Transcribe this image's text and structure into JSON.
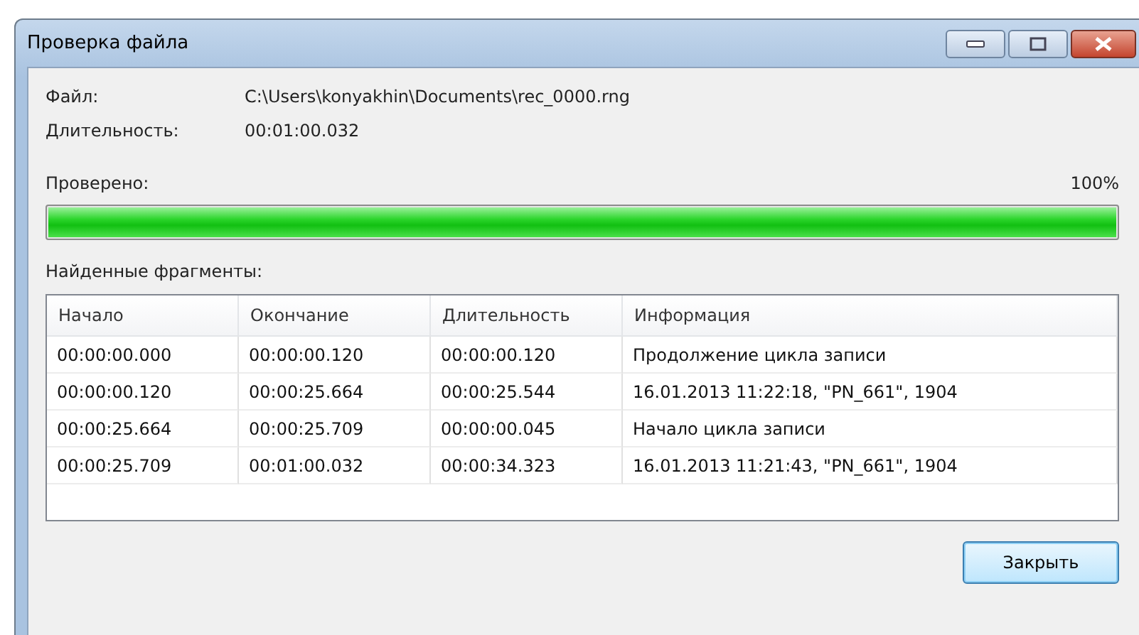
{
  "window": {
    "title": "Проверка файла"
  },
  "file": {
    "label": "Файл:",
    "value": "C:\\Users\\konyakhin\\Documents\\rec_0000.rng"
  },
  "duration": {
    "label": "Длительность:",
    "value": "00:01:00.032"
  },
  "progress": {
    "label": "Проверено:",
    "reading": "100%",
    "level": 1
  },
  "fragments": {
    "label": "Найденные фрагменты:",
    "columns": [
      "Начало",
      "Окончание",
      "Длительность",
      "Информация"
    ],
    "rows": [
      [
        "00:00:00.000",
        "00:00:00.120",
        "00:00:00.120",
        "Продолжение цикла записи"
      ],
      [
        "00:00:00.120",
        "00:00:25.664",
        "00:00:25.544",
        "16.01.2013 11:22:18, \"PN_661\", 1904"
      ],
      [
        "00:00:25.664",
        "00:00:25.709",
        "00:00:00.045",
        "Начало цикла записи"
      ],
      [
        "00:00:25.709",
        "00:01:00.032",
        "00:00:34.323",
        "16.01.2013 11:21:43, \"PN_661\", 1904"
      ]
    ]
  },
  "buttons": [
    "Закрыть"
  ]
}
